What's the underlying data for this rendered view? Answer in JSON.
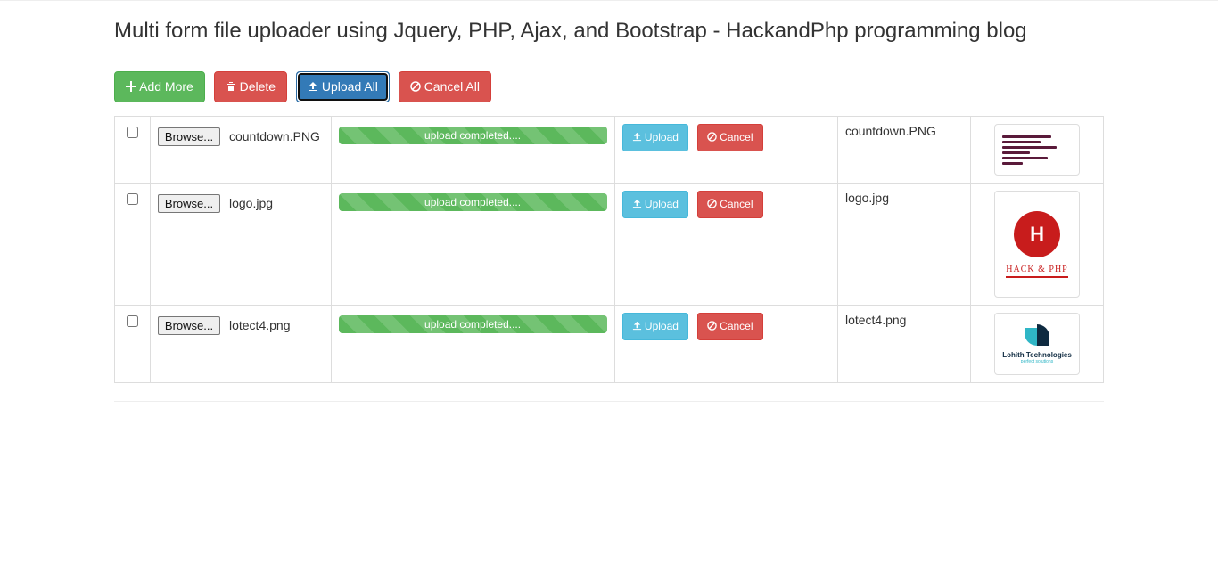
{
  "header": {
    "title": "Multi form file uploader using Jquery, PHP, Ajax, and Bootstrap - HackandPhp programming blog"
  },
  "toolbar": {
    "add_more": "Add More",
    "delete": "Delete",
    "upload_all": "Upload All",
    "cancel_all": "Cancel All"
  },
  "common": {
    "browse": "Browse...",
    "upload": "Upload",
    "cancel": "Cancel",
    "progress_text": "upload completed...."
  },
  "rows": [
    {
      "selected_file": "countdown.PNG",
      "uploaded_name": "countdown.PNG",
      "thumb": "countdown"
    },
    {
      "selected_file": "logo.jpg",
      "uploaded_name": "logo.jpg",
      "thumb": "logo"
    },
    {
      "selected_file": "lotect4.png",
      "uploaded_name": "lotect4.png",
      "thumb": "lohith"
    }
  ]
}
